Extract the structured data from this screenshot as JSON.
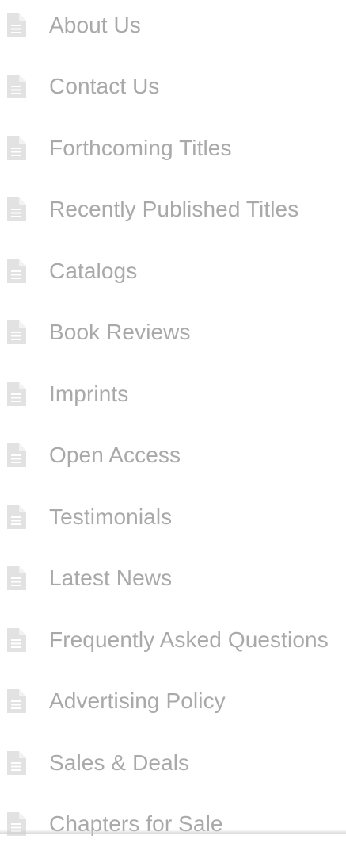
{
  "menu": {
    "icon": "document-icon",
    "icon_color": "#e2e2e2",
    "text_color": "#a9a9a9",
    "items": [
      {
        "label": "About Us"
      },
      {
        "label": "Contact Us"
      },
      {
        "label": "Forthcoming Titles"
      },
      {
        "label": "Recently Published Titles"
      },
      {
        "label": "Catalogs"
      },
      {
        "label": "Book Reviews"
      },
      {
        "label": "Imprints"
      },
      {
        "label": "Open Access"
      },
      {
        "label": "Testimonials"
      },
      {
        "label": "Latest News"
      },
      {
        "label": "Frequently Asked Questions"
      },
      {
        "label": "Advertising Policy"
      },
      {
        "label": "Sales & Deals"
      },
      {
        "label": "Chapters for Sale"
      }
    ]
  }
}
